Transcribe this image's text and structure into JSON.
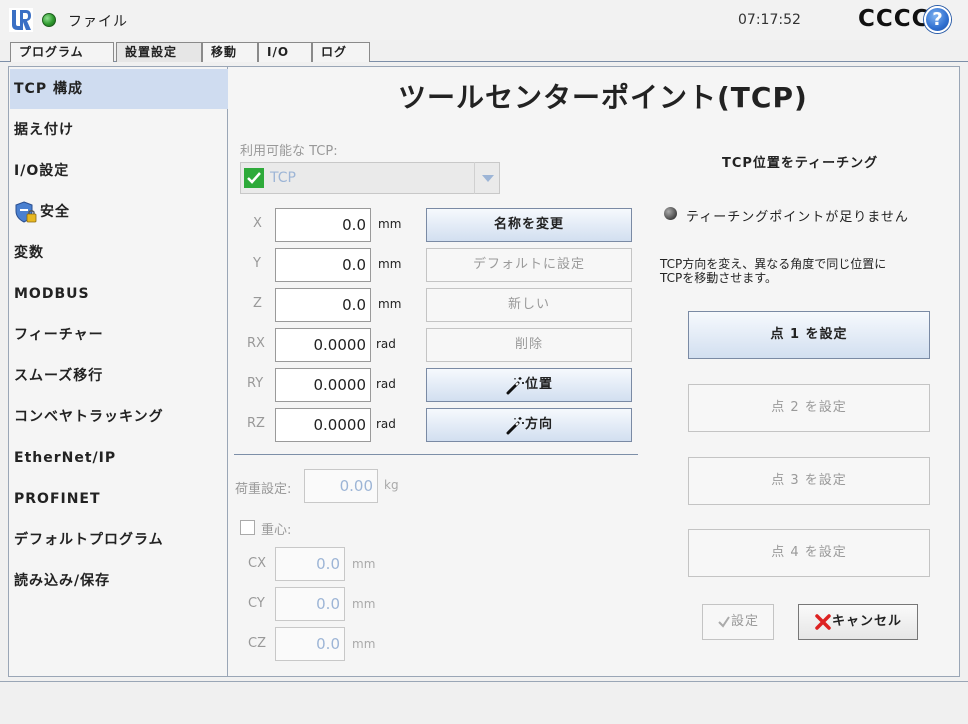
{
  "titlebar": {
    "file_menu": "ファイル",
    "clock": "07:17:52",
    "robot_name": "CCCC",
    "help": "?"
  },
  "tabs": [
    {
      "label": "プログラム"
    },
    {
      "label": "設置設定",
      "active": true
    },
    {
      "label": "移動"
    },
    {
      "label": "I/O"
    },
    {
      "label": "ログ"
    }
  ],
  "nav": [
    {
      "label": "TCP 構成",
      "selected": true
    },
    {
      "label": "据え付け"
    },
    {
      "label": "I/O設定"
    },
    {
      "label": "安全"
    },
    {
      "label": "変数"
    },
    {
      "label": "MODBUS"
    },
    {
      "label": "フィーチャー"
    },
    {
      "label": "スムーズ移行"
    },
    {
      "label": "コンベヤトラッキング"
    },
    {
      "label": "EtherNet/IP"
    },
    {
      "label": "PROFINET"
    },
    {
      "label": "デフォルトプログラム"
    },
    {
      "label": "読み込み/保存"
    }
  ],
  "main": {
    "title": "ツールセンターポイント(TCP)",
    "available_tcp_label": "利用可能な TCP:",
    "tcp_selected": "TCP",
    "coords": [
      {
        "label": "X",
        "value": "0.0",
        "unit": "mm"
      },
      {
        "label": "Y",
        "value": "0.0",
        "unit": "mm"
      },
      {
        "label": "Z",
        "value": "0.0",
        "unit": "mm"
      },
      {
        "label": "RX",
        "value": "0.0000",
        "unit": "rad"
      },
      {
        "label": "RY",
        "value": "0.0000",
        "unit": "rad"
      },
      {
        "label": "RZ",
        "value": "0.0000",
        "unit": "rad"
      }
    ],
    "buttons": {
      "rename": "名称を変更",
      "set_default": "デフォルトに設定",
      "new": "新しい",
      "delete": "削除",
      "position": "位置",
      "orientation": "方向"
    },
    "payload_label": "荷重設定:",
    "payload_value": "0.00",
    "payload_unit": "kg",
    "cog_label": "重心:",
    "cog": [
      {
        "label": "CX",
        "value": "0.0",
        "unit": "mm"
      },
      {
        "label": "CY",
        "value": "0.0",
        "unit": "mm"
      },
      {
        "label": "CZ",
        "value": "0.0",
        "unit": "mm"
      }
    ]
  },
  "teach": {
    "title": "TCP位置をティーチング",
    "status": "ティーチングポイントが足りません",
    "instructions_line1": "TCP方向を変え、異なる角度で同じ位置に",
    "instructions_line2": "TCPを移動させます。",
    "point1": "点 1 を設定",
    "point2": "点 2 を設定",
    "point3": "点 3 を設定",
    "point4": "点 4 を設定",
    "set": "設定",
    "cancel": "キャンセル"
  }
}
